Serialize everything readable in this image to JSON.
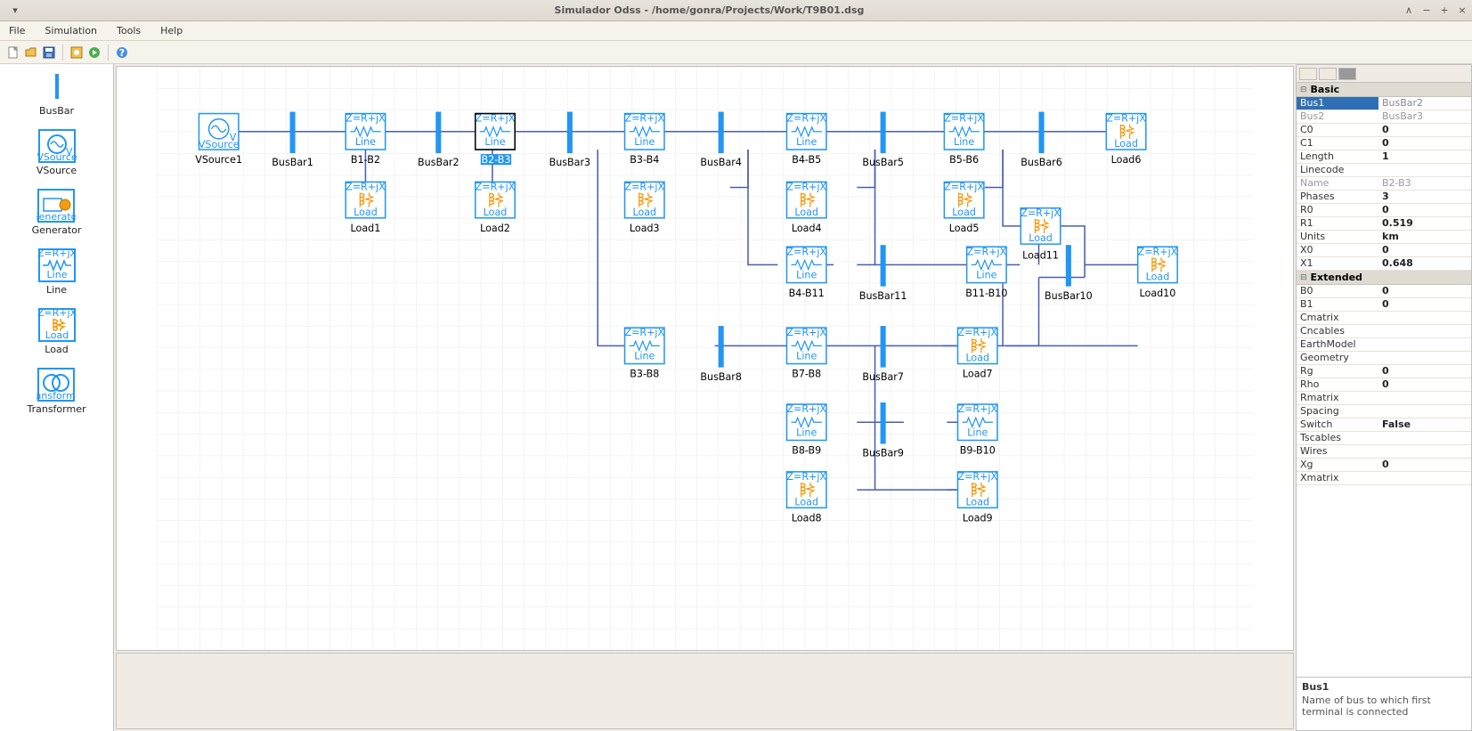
{
  "window": {
    "title": "Simulador Odss - /home/gonra/Projects/Work/T9B01.dsg"
  },
  "menu": {
    "file": "File",
    "simulation": "Simulation",
    "tools": "Tools",
    "help": "Help"
  },
  "palette": {
    "busbar": "BusBar",
    "vsource": "VSource",
    "generator": "Generator",
    "line": "Line",
    "load": "Load",
    "transformer": "Transformer"
  },
  "canvas": {
    "line_label_top": "Z=R+jX",
    "line_label_bot": "Line",
    "load_label": "Load",
    "vsource": "VSource",
    "items": {
      "VSource1": "VSource1",
      "BusBar1": "BusBar1",
      "BusBar2": "BusBar2",
      "BusBar3": "BusBar3",
      "BusBar4": "BusBar4",
      "BusBar5": "BusBar5",
      "BusBar6": "BusBar6",
      "BusBar7": "BusBar7",
      "BusBar8": "BusBar8",
      "BusBar9": "BusBar9",
      "BusBar10": "BusBar10",
      "BusBar11": "BusBar11",
      "B1-B2": "B1-B2",
      "B2-B3": "B2-B3",
      "B3-B4": "B3-B4",
      "B4-B5": "B4-B5",
      "B5-B6": "B5-B6",
      "B3-B8": "B3-B8",
      "B4-B11": "B4-B11",
      "B7-B8": "B7-B8",
      "B8-B9": "B8-B9",
      "B9-B10": "B9-B10",
      "B11-B10": "B11-B10",
      "Load1": "Load1",
      "Load2": "Load2",
      "Load3": "Load3",
      "Load4": "Load4",
      "Load5": "Load5",
      "Load6": "Load6",
      "Load7": "Load7",
      "Load8": "Load8",
      "Load9": "Load9",
      "Load10": "Load10",
      "Load11": "Load11"
    }
  },
  "props": {
    "basic": {
      "header": "Basic",
      "Bus1": {
        "k": "Bus1",
        "v": "BusBar2"
      },
      "Bus2": {
        "k": "Bus2",
        "v": "BusBar3"
      },
      "C0": {
        "k": "C0",
        "v": "0"
      },
      "C1": {
        "k": "C1",
        "v": "0"
      },
      "Length": {
        "k": "Length",
        "v": "1"
      },
      "Linecode": {
        "k": "Linecode",
        "v": ""
      },
      "Name": {
        "k": "Name",
        "v": "B2-B3"
      },
      "Phases": {
        "k": "Phases",
        "v": "3"
      },
      "R0": {
        "k": "R0",
        "v": "0"
      },
      "R1": {
        "k": "R1",
        "v": "0.519"
      },
      "Units": {
        "k": "Units",
        "v": "km"
      },
      "X0": {
        "k": "X0",
        "v": "0"
      },
      "X1": {
        "k": "X1",
        "v": "0.648"
      }
    },
    "extended": {
      "header": "Extended",
      "B0": {
        "k": "B0",
        "v": "0"
      },
      "B1": {
        "k": "B1",
        "v": "0"
      },
      "Cmatrix": {
        "k": "Cmatrix",
        "v": ""
      },
      "Cncables": {
        "k": "Cncables",
        "v": ""
      },
      "EarthModel": {
        "k": "EarthModel",
        "v": ""
      },
      "Geometry": {
        "k": "Geometry",
        "v": ""
      },
      "Rg": {
        "k": "Rg",
        "v": "0"
      },
      "Rho": {
        "k": "Rho",
        "v": "0"
      },
      "Rmatrix": {
        "k": "Rmatrix",
        "v": ""
      },
      "Spacing": {
        "k": "Spacing",
        "v": ""
      },
      "Switch": {
        "k": "Switch",
        "v": "False"
      },
      "Tscables": {
        "k": "Tscables",
        "v": ""
      },
      "Wires": {
        "k": "Wires",
        "v": ""
      },
      "Xg": {
        "k": "Xg",
        "v": "0"
      },
      "Xmatrix": {
        "k": "Xmatrix",
        "v": ""
      }
    },
    "desc": {
      "title": "Bus1",
      "text": "Name of bus to which first terminal is connected"
    }
  }
}
